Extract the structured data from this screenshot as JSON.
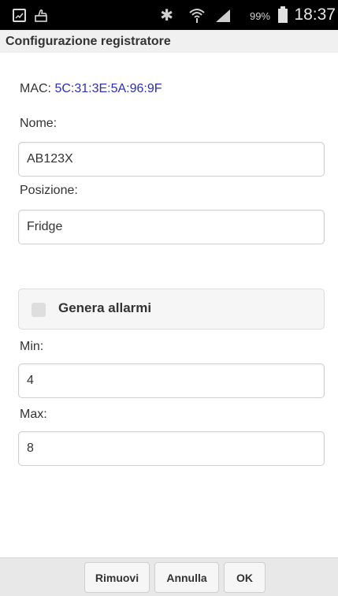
{
  "status_bar": {
    "left_icons": [
      "image-icon",
      "hand-icon"
    ],
    "right_icons": [
      "bluetooth-icon",
      "wifi-icon",
      "signal-icon",
      "battery-icon"
    ],
    "battery": "99%",
    "time": "18:37"
  },
  "header": {
    "title": "Configurazione registratore"
  },
  "mac": {
    "label": "MAC:",
    "value": "5C:31:3E:5A:96:9F",
    "value_color": "#2d2db8"
  },
  "form": {
    "nome_label": "Nome:",
    "nome_value": "AB123X",
    "posizione_label": "Posizione:",
    "posizione_value": "Fridge",
    "alarm_label": "Genera allarmi",
    "alarm_checked": false,
    "min_label": "Min:",
    "min_value": "4",
    "max_label": "Max:",
    "max_value": "8"
  },
  "footer": {
    "remove_label": "Rimuovi",
    "cancel_label": "Annulla",
    "ok_label": "OK"
  }
}
